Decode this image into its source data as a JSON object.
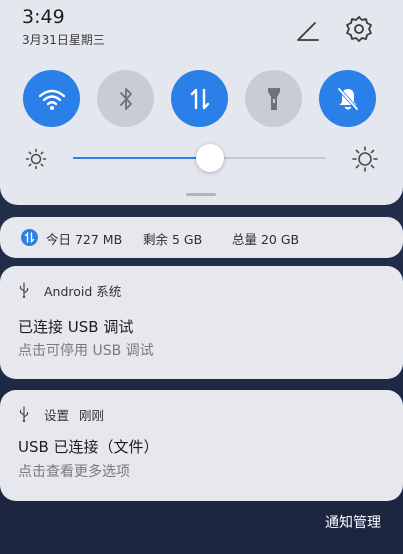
{
  "status": {
    "time": "3:49",
    "date": "3月31日星期三"
  },
  "header": {
    "edit_icon": "pencil-icon",
    "settings_icon": "gear-icon"
  },
  "toggles": [
    {
      "name": "wifi",
      "icon": "wifi-icon",
      "state": "on"
    },
    {
      "name": "bluetooth",
      "icon": "bluetooth-icon",
      "state": "off"
    },
    {
      "name": "mobile-data",
      "icon": "data-transfer-icon",
      "state": "on"
    },
    {
      "name": "flashlight",
      "icon": "flashlight-icon",
      "state": "off"
    },
    {
      "name": "do-not-disturb",
      "icon": "bell-off-icon",
      "state": "on"
    }
  ],
  "brightness": {
    "level": 0.54
  },
  "data_usage": {
    "today": "今日 727 MB",
    "remaining": "剩余 5 GB",
    "total": "总量 20 GB"
  },
  "notifications": [
    {
      "app": "Android 系统",
      "time": "",
      "title": "已连接 USB 调试",
      "subtitle": "点击可停用 USB 调试"
    },
    {
      "app": "设置",
      "time": "刚刚",
      "title": "USB 已连接（文件）",
      "subtitle": "点击查看更多选项"
    }
  ],
  "footer": {
    "manage_label": "通知管理"
  },
  "colors": {
    "accent": "#2a7fe8",
    "panel": "#e4e7ee",
    "background": "#1f2b46"
  }
}
